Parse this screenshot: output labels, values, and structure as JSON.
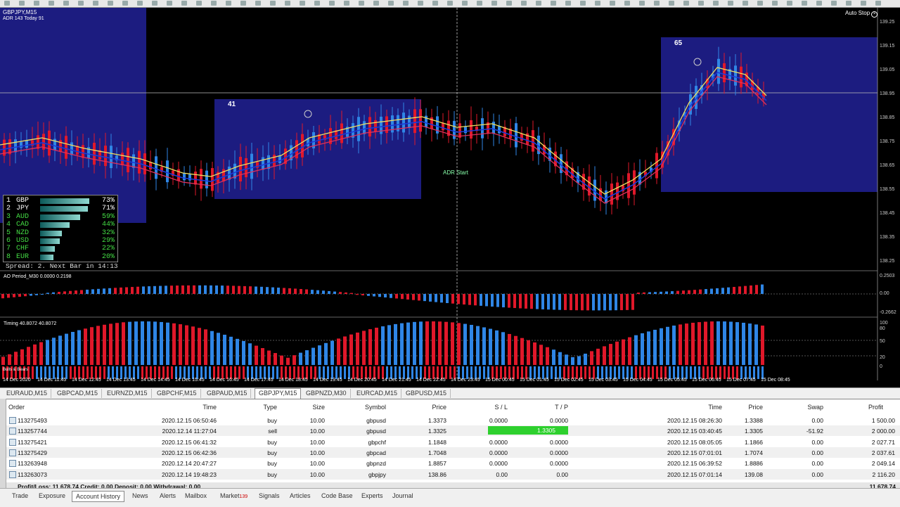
{
  "window": {
    "symbol_title": "GBPJPY,M15",
    "adr_info": "ADR 143  Today 91",
    "auto_stop": "Auto Stop"
  },
  "chart": {
    "box_labels": [
      "41",
      "65"
    ],
    "adr_start_label": "ADR Start",
    "price_levels": [
      "139.25",
      "139.15",
      "139.05",
      "138.95",
      "138.85",
      "138.75",
      "138.65",
      "138.55",
      "138.45",
      "138.35",
      "138.25"
    ],
    "ao_label": "AO Period_M30 0.0000 0.2198",
    "ao_levels": [
      "0.2503",
      "0.00",
      "-0.2662"
    ],
    "timing_label": "Timing 40.8072 40.8072",
    "timing_levels": [
      "100",
      "80",
      "50",
      "20",
      "0"
    ],
    "bulls_bears_label": "Bulls & Bears",
    "time_labels": [
      "14 Dec 2020",
      "14 Dec 11:45",
      "14 Dec 12:45",
      "14 Dec 13:45",
      "14 Dec 14:45",
      "14 Dec 15:45",
      "14 Dec 16:45",
      "14 Dec 17:45",
      "14 Dec 18:45",
      "14 Dec 19:45",
      "14 Dec 20:45",
      "14 Dec 21:45",
      "14 Dec 22:45",
      "14 Dec 23:45",
      "15 Dec 00:45",
      "15 Dec 01:45",
      "15 Dec 02:45",
      "15 Dec 03:45",
      "15 Dec 04:45",
      "15 Dec 05:45",
      "15 Dec 06:45",
      "15 Dec 07:45",
      "15 Dec 08:45"
    ],
    "colors": {
      "bull": "#2f86e6",
      "bear": "#e0182a",
      "box": "#1c1c80",
      "ma_yellow": "#f0e060",
      "ma_red": "#e0305a",
      "ma_blue": "#1a3ad8"
    }
  },
  "strength": {
    "rows": [
      {
        "rank": "1",
        "ccy": "GBP",
        "pct": "73%",
        "level": 0.73,
        "color": "#ffffff"
      },
      {
        "rank": "2",
        "ccy": "JPY",
        "pct": "71%",
        "level": 0.71,
        "color": "#ffffff"
      },
      {
        "rank": "3",
        "ccy": "AUD",
        "pct": "59%",
        "level": 0.59,
        "color": "#44dd44"
      },
      {
        "rank": "4",
        "ccy": "CAD",
        "pct": "44%",
        "level": 0.44,
        "color": "#44dd44"
      },
      {
        "rank": "5",
        "ccy": "NZD",
        "pct": "32%",
        "level": 0.32,
        "color": "#44dd44"
      },
      {
        "rank": "6",
        "ccy": "USD",
        "pct": "29%",
        "level": 0.29,
        "color": "#44dd44"
      },
      {
        "rank": "7",
        "ccy": "CHF",
        "pct": "22%",
        "level": 0.22,
        "color": "#44dd44"
      },
      {
        "rank": "8",
        "ccy": "EUR",
        "pct": "20%",
        "level": 0.2,
        "color": "#44dd44"
      }
    ],
    "spread_text": "Spread: 2.  Next Bar in 14:13"
  },
  "symbol_tabs": [
    "EURAUD,M15",
    "GBPCAD,M15",
    "EURNZD,M15",
    "GBPCHF,M15",
    "GBPAUD,M15",
    "GBPJPY,M15",
    "GBPNZD,M30",
    "EURCAD,M15",
    "GBPUSD,M15"
  ],
  "active_symbol_tab": 5,
  "table": {
    "headers": [
      "Order",
      "Time",
      "Type",
      "Size",
      "Symbol",
      "Price",
      "S / L",
      "T / P",
      "Time",
      "Price",
      "Swap",
      "Profit"
    ],
    "rows": [
      {
        "order": "113275493",
        "time": "2020.12.15 06:50:46",
        "type": "buy",
        "size": "10.00",
        "symbol": "gbpusd",
        "price": "1.3373",
        "sl": "0.0000",
        "tp": "0.0000",
        "ctime": "2020.12.15 08:26:30",
        "cprice": "1.3388",
        "swap": "0.00",
        "profit": "1 500.00"
      },
      {
        "order": "113257744",
        "time": "2020.12.14 11:27:04",
        "type": "sell",
        "size": "10.00",
        "symbol": "gbpusd",
        "price": "1.3325",
        "sl": "0.0000",
        "tp": "1.3305",
        "ctime": "2020.12.15 03:40:45",
        "cprice": "1.3305",
        "swap": "-51.92",
        "profit": "2 000.00",
        "tp_hit": true
      },
      {
        "order": "113275421",
        "time": "2020.12.15 06:41:32",
        "type": "buy",
        "size": "10.00",
        "symbol": "gbpchf",
        "price": "1.1848",
        "sl": "0.0000",
        "tp": "0.0000",
        "ctime": "2020.12.15 08:05:05",
        "cprice": "1.1866",
        "swap": "0.00",
        "profit": "2 027.71"
      },
      {
        "order": "113275429",
        "time": "2020.12.15 06:42:36",
        "type": "buy",
        "size": "10.00",
        "symbol": "gbpcad",
        "price": "1.7048",
        "sl": "0.0000",
        "tp": "0.0000",
        "ctime": "2020.12.15 07:01:01",
        "cprice": "1.7074",
        "swap": "0.00",
        "profit": "2 037.61"
      },
      {
        "order": "113263948",
        "time": "2020.12.14 20:47:27",
        "type": "buy",
        "size": "10.00",
        "symbol": "gbpnzd",
        "price": "1.8857",
        "sl": "0.0000",
        "tp": "0.0000",
        "ctime": "2020.12.15 06:39:52",
        "cprice": "1.8886",
        "swap": "0.00",
        "profit": "2 049.14"
      },
      {
        "order": "113263073",
        "time": "2020.12.14 19:48:23",
        "type": "buy",
        "size": "10.00",
        "symbol": "gbpjpy",
        "price": "138.86",
        "sl": "0.00",
        "tp": "0.00",
        "ctime": "2020.12.15 07:01:14",
        "cprice": "139.08",
        "swap": "0.00",
        "profit": "2 116.20"
      }
    ],
    "summary": "Profit/Loss: 11 678.74  Credit: 0.00  Deposit: 0.00  Withdrawal: 0.00",
    "total": "11 678.74"
  },
  "bottom_tabs": [
    {
      "label": "Trade"
    },
    {
      "label": "Exposure"
    },
    {
      "label": "Account History",
      "active": true
    },
    {
      "label": "News"
    },
    {
      "label": "Alerts"
    },
    {
      "label": "Mailbox"
    },
    {
      "label": "Market",
      "badge": "139"
    },
    {
      "label": "Signals"
    },
    {
      "label": "Articles"
    },
    {
      "label": "Code Base"
    },
    {
      "label": "Experts"
    },
    {
      "label": "Journal"
    }
  ]
}
